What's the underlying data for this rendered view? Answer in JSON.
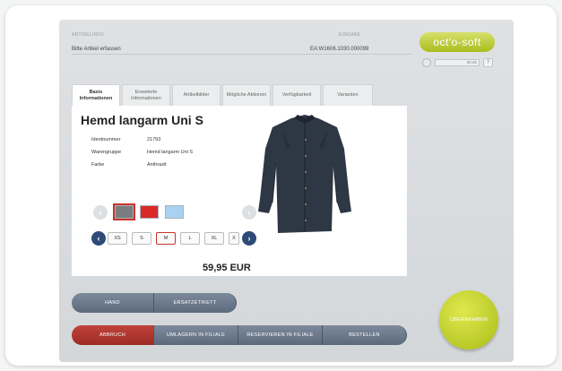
{
  "header": {
    "article_label": "ARTIKELINFO",
    "article_prompt": "Bitte Artikel erfassen",
    "input_label": "EINGABE",
    "input_value": "EA:W1606.1030.000099"
  },
  "brand": {
    "logo_text": "oct'o-soft",
    "accent": "#b7c62a"
  },
  "mini_panel": {
    "field_value": "59.95",
    "help": "?"
  },
  "tabs": [
    {
      "label": "Basis Informationen",
      "active": true
    },
    {
      "label": "Erweiterte Informationen"
    },
    {
      "label": "Artikelbilder"
    },
    {
      "label": "Mögliche Aktionen"
    },
    {
      "label": "Verfügbarkeit"
    },
    {
      "label": "Varianten"
    }
  ],
  "product": {
    "title": "Hemd langarm Uni S",
    "info": [
      {
        "key": "Identnummer",
        "value": "21793"
      },
      {
        "key": "Warengruppe",
        "value": "Hemd langarm Uni S"
      },
      {
        "key": "Farbe",
        "value": "Anthrazit"
      }
    ],
    "colors": [
      "#7a7d80",
      "#d92a2a",
      "#a9d2f0"
    ],
    "selected_color_index": 0,
    "sizes": [
      "XS",
      "S",
      "M",
      "L",
      "XL",
      "X"
    ],
    "selected_size": "M",
    "price": "59,95 EUR"
  },
  "buttons": {
    "hand": "HAND",
    "ersatzetikett": "ERSATZETIKETT",
    "abbruch": "ABBRUCH",
    "umlagern": "UMLAGERN IN FILIALE",
    "reservieren": "RESERVIEREN IN FILIALE",
    "bestellen": "BESTELLEN",
    "uebernehmen": "ÜBERNEHMEN"
  },
  "icons": {
    "prev": "chevron-left-icon",
    "next": "chevron-right-icon"
  }
}
